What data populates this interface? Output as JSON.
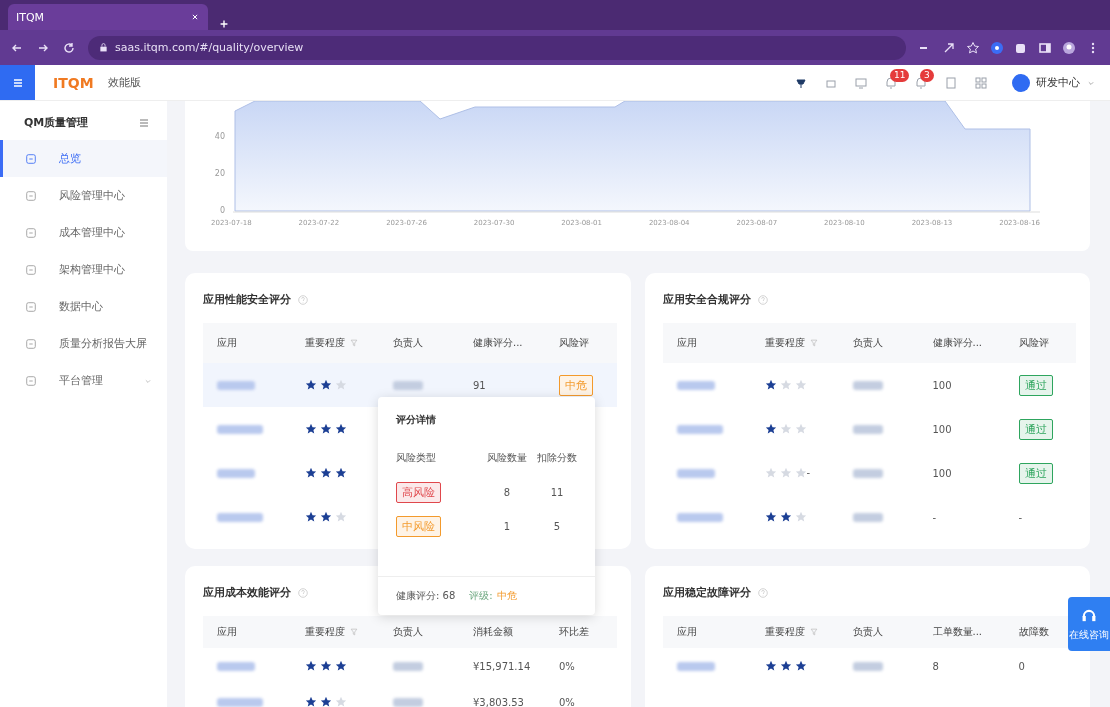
{
  "browser": {
    "tab_title": "ITQM",
    "url": "saas.itqm.com/#/quality/overview"
  },
  "header": {
    "logo": "ITQM",
    "product": "效能版",
    "badges": [
      "11",
      "3"
    ],
    "user": "研发中心"
  },
  "sidebar": {
    "title": "QM质量管理",
    "items": [
      {
        "label": "总览",
        "selected": true
      },
      {
        "label": "风险管理中心",
        "selected": false
      },
      {
        "label": "成本管理中心",
        "selected": false
      },
      {
        "label": "架构管理中心",
        "selected": false
      },
      {
        "label": "数据中心",
        "selected": false
      },
      {
        "label": "质量分析报告大屏",
        "selected": false
      },
      {
        "label": "平台管理",
        "selected": false,
        "expanded": false
      }
    ]
  },
  "trend_chart": {
    "y_ticks": [
      "40",
      "20",
      "0"
    ],
    "x_labels": [
      "2023-07-18",
      "2023-07-22",
      "2023-07-26",
      "2023-07-30",
      "2023-08-01",
      "2023-08-04",
      "2023-08-07",
      "2023-08-10",
      "2023-08-13",
      "2023-08-16"
    ]
  },
  "cards": [
    {
      "title": "应用性能安全评分",
      "columns": [
        "应用",
        "重要程度",
        "负责人",
        "健康评分...",
        "风险评"
      ],
      "rows": [
        {
          "stars": 2,
          "col_4": "91",
          "risk": {
            "label": "中危",
            "color": "#f39a2c"
          }
        },
        {
          "stars": 3
        },
        {
          "stars": 3
        },
        {
          "stars": 2
        }
      ]
    },
    {
      "title": "应用安全合规评分",
      "columns": [
        "应用",
        "重要程度",
        "负责人",
        "健康评分...",
        "风险评"
      ],
      "rows": [
        {
          "stars": 1,
          "col_4": "100",
          "risk": {
            "label": "通过",
            "color": "#2ea55e"
          }
        },
        {
          "stars": 1,
          "col_4": "100",
          "risk": {
            "label": "通过",
            "color": "#2ea55e"
          }
        },
        {
          "stars": 0,
          "empty_text": "-",
          "col_4": "100",
          "risk": {
            "label": "通过",
            "color": "#2ea55e"
          }
        },
        {
          "stars": 2,
          "col_4": "-",
          "col_5": "-"
        }
      ]
    },
    {
      "title": "应用成本效能评分",
      "columns": [
        "应用",
        "重要程度",
        "负责人",
        "消耗金额",
        "环比差"
      ],
      "rows": [
        {
          "stars": 3,
          "col_4": "¥15,971.14",
          "col_5": "0%"
        },
        {
          "stars": 2,
          "col_4": "¥3,803.53",
          "col_5": "0%"
        }
      ]
    },
    {
      "title": "应用稳定故障评分",
      "columns": [
        "应用",
        "重要程度",
        "负责人",
        "工单数量...",
        "故障数"
      ],
      "rows": [
        {
          "stars": 3,
          "col_4": "8",
          "col_5": "0"
        }
      ]
    }
  ],
  "tooltip": {
    "title": "评分详情",
    "columns": [
      "风险类型",
      "风险数量",
      "扣除分数"
    ],
    "rows": [
      {
        "label": "高风险",
        "color": "#e0474c",
        "count": "8",
        "deduction": "11"
      },
      {
        "label": "中风险",
        "color": "#f39a2c",
        "count": "1",
        "deduction": "5"
      }
    ],
    "score": "健康评分: 68",
    "rating_label": "评级:",
    "rating_value": "中危"
  },
  "help_button": {
    "label": "在线咨询"
  }
}
